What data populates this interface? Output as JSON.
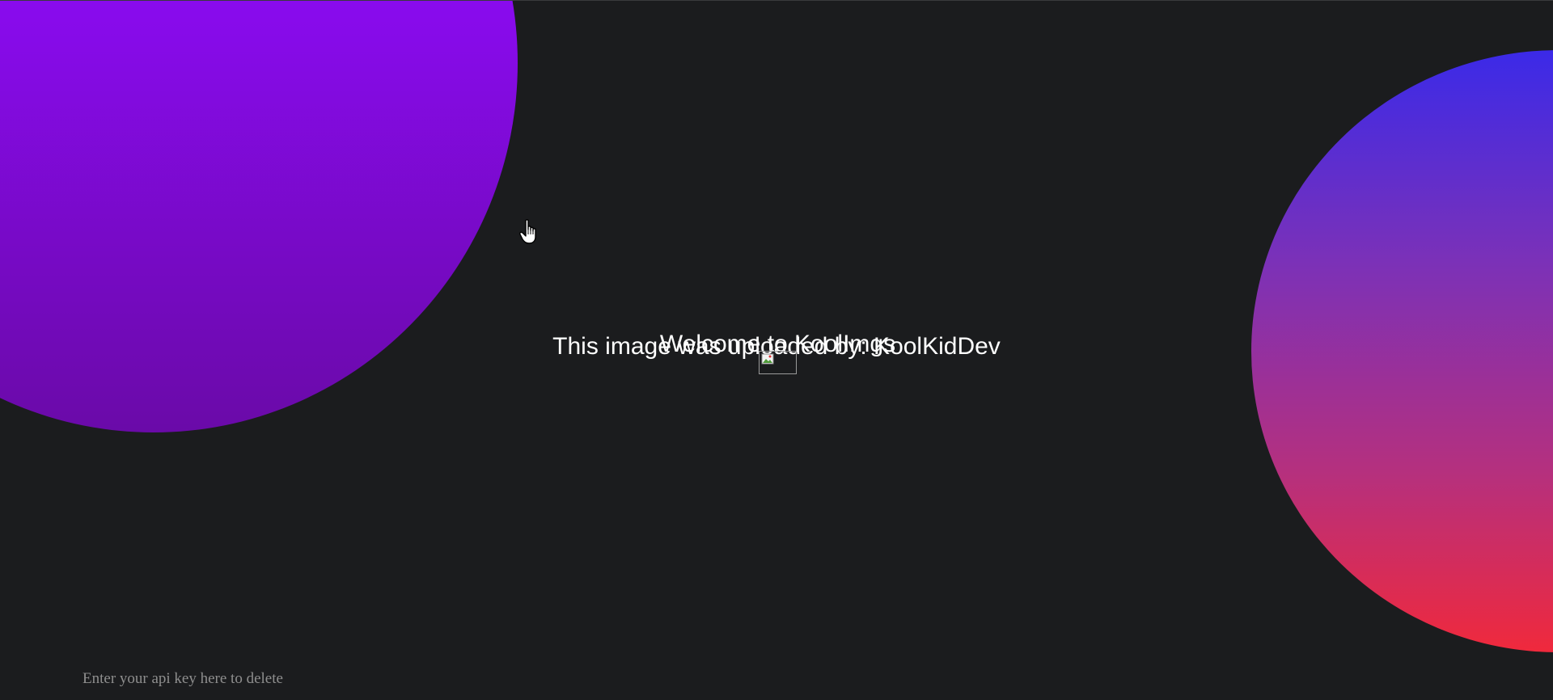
{
  "welcome": {
    "title": "Welcome to KoolImgs"
  },
  "image_info": {
    "uploaded_by": "This image was uploaded by: KoolKidDev"
  },
  "delete_form": {
    "api_key_placeholder": "Enter your api key here to delete",
    "api_key_value": ""
  },
  "colors": {
    "background": "#1b1c1e",
    "left_blob_top": "#8a0bf0",
    "left_blob_bottom": "#6a0aa8",
    "right_blob_top": "#3b2ae8",
    "right_blob_bottom": "#f0293c",
    "text": "#ffffff"
  },
  "icons": {
    "cursor": "hand-pointer-icon",
    "broken_image": "broken-image-icon"
  }
}
